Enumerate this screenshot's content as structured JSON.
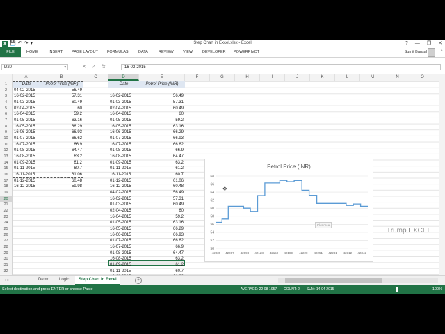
{
  "window": {
    "title": "Step Chart in Excel.xlsx - Excel",
    "help": "?",
    "minimize": "—",
    "restore": "❐",
    "close": "✕"
  },
  "quick_access": {
    "app_icon": "X",
    "save": "💾",
    "undo": "↶",
    "redo": "↷",
    "custom": "▾"
  },
  "ribbon": {
    "tabs": [
      "FILE",
      "HOME",
      "INSERT",
      "PAGE LAYOUT",
      "FORMULAS",
      "DATA",
      "REVIEW",
      "VIEW",
      "DEVELOPER",
      "POWERPIVOT"
    ],
    "user": "Sumit Bansal",
    "collapse": "˄"
  },
  "formula_bar": {
    "name_box": "D20",
    "cancel": "✕",
    "enter": "✓",
    "fx": "fx",
    "value": "16-02-2015"
  },
  "columns": [
    "A",
    "B",
    "C",
    "D",
    "E",
    "F",
    "G",
    "H",
    "I",
    "J",
    "K",
    "L",
    "M",
    "N",
    "O"
  ],
  "rows": [
    "1",
    "2",
    "3",
    "4",
    "5",
    "6",
    "7",
    "8",
    "9",
    "10",
    "11",
    "12",
    "13",
    "14",
    "15",
    "16",
    "17",
    "18",
    "19",
    "20",
    "21",
    "22",
    "23",
    "24",
    "25",
    "26",
    "27",
    "28",
    "29",
    "30",
    "31",
    "32",
    "33"
  ],
  "table_a": {
    "headers": [
      "Date",
      "Petrol Price (INR)"
    ],
    "rows": [
      [
        "04-02-2015",
        "56.49"
      ],
      [
        "16-02-2015",
        "57.31"
      ],
      [
        "01-03-2015",
        "60.49"
      ],
      [
        "02-04-2015",
        "60"
      ],
      [
        "16-04-2015",
        "59.2"
      ],
      [
        "01-05-2015",
        "63.16"
      ],
      [
        "16-05-2015",
        "66.29"
      ],
      [
        "16-06-2015",
        "66.93"
      ],
      [
        "01-07-2015",
        "66.62"
      ],
      [
        "16-07-2015",
        "66.9"
      ],
      [
        "01-08-2015",
        "64.47"
      ],
      [
        "16-08-2015",
        "63.2"
      ],
      [
        "01-09-2015",
        "61.2"
      ],
      [
        "01-11-2015",
        "60.7"
      ],
      [
        "16-11-2015",
        "61.06"
      ],
      [
        "01-12-2015",
        "60.48"
      ],
      [
        "16-12-2015",
        "59.98"
      ]
    ]
  },
  "table_d": {
    "headers": [
      "Date",
      "Petrol Price (INR)"
    ],
    "rows": [
      [
        "16-02-2015",
        "56.49"
      ],
      [
        "01-03-2015",
        "57.31"
      ],
      [
        "02-04-2015",
        "60.49"
      ],
      [
        "16-04-2015",
        "60"
      ],
      [
        "01-05-2015",
        "59.2"
      ],
      [
        "16-05-2015",
        "63.16"
      ],
      [
        "16-06-2015",
        "66.29"
      ],
      [
        "01-07-2015",
        "66.93"
      ],
      [
        "16-07-2015",
        "66.62"
      ],
      [
        "01-08-2015",
        "66.9"
      ],
      [
        "16-08-2015",
        "64.47"
      ],
      [
        "01-09-2015",
        "63.2"
      ],
      [
        "01-11-2015",
        "61.2"
      ],
      [
        "16-11-2015",
        "60.7"
      ],
      [
        "01-12-2015",
        "61.06"
      ],
      [
        "16-12-2015",
        "60.48"
      ],
      [
        "04-02-2015",
        "56.49"
      ],
      [
        "16-02-2015",
        "57.31"
      ],
      [
        "01-03-2015",
        "60.49"
      ],
      [
        "02-04-2015",
        "60"
      ],
      [
        "16-04-2015",
        "59.2"
      ],
      [
        "01-05-2015",
        "63.16"
      ],
      [
        "16-05-2015",
        "66.29"
      ],
      [
        "16-06-2015",
        "66.93"
      ],
      [
        "01-07-2015",
        "66.62"
      ],
      [
        "16-07-2015",
        "66.9"
      ],
      [
        "01-08-2015",
        "64.47"
      ],
      [
        "16-08-2015",
        "63.2"
      ],
      [
        "01-09-2015",
        "61.2"
      ],
      [
        "01-11-2015",
        "60.7"
      ],
      [
        "16-11-2015",
        "61.06"
      ]
    ]
  },
  "chart_data": {
    "type": "line",
    "title": "Petrol Price (INR)",
    "x_tick_labels": [
      "42039",
      "42067",
      "42098",
      "42128",
      "42159",
      "42189",
      "42220",
      "42251",
      "42281",
      "42312",
      "42342"
    ],
    "y_tick_labels": [
      "50",
      "52",
      "54",
      "56",
      "58",
      "60",
      "62",
      "64",
      "66",
      "68"
    ],
    "xlim": [
      42039,
      42354
    ],
    "ylim": [
      50,
      68
    ],
    "grid": true,
    "series": [
      {
        "color": "#5b9bd5",
        "x": [
          42039,
          42051,
          42051,
          42064,
          42064,
          42096,
          42096,
          42110,
          42110,
          42125,
          42125,
          42140,
          42140,
          42171,
          42171,
          42186,
          42186,
          42201,
          42201,
          42217,
          42217,
          42232,
          42232,
          42248,
          42248,
          42309,
          42309,
          42324,
          42324,
          42339,
          42339,
          42354
        ],
        "values": [
          56.49,
          56.49,
          57.31,
          57.31,
          60.49,
          60.49,
          60,
          60,
          59.2,
          59.2,
          63.16,
          63.16,
          66.29,
          66.29,
          66.93,
          66.93,
          66.62,
          66.62,
          66.9,
          66.9,
          64.47,
          64.47,
          63.2,
          63.2,
          61.2,
          61.2,
          60.7,
          60.7,
          61.06,
          61.06,
          60.48,
          60.48
        ]
      }
    ],
    "plot_area_tag": "Plot Area"
  },
  "sheets": {
    "tabs": [
      "Demo",
      "Logic",
      "Step Chart in Excel"
    ],
    "active_index": 2,
    "add": "+",
    "nav": "◂ ▸"
  },
  "status_bar": {
    "message": "Select destination and press ENTER or choose Paste",
    "average": "AVERAGE: 22-08-1957",
    "count": "COUNT: 2",
    "sum": "SUM: 14-04-2015",
    "zoom": "100%"
  },
  "watermark": "Trump EXCEL",
  "cursor": "✥"
}
